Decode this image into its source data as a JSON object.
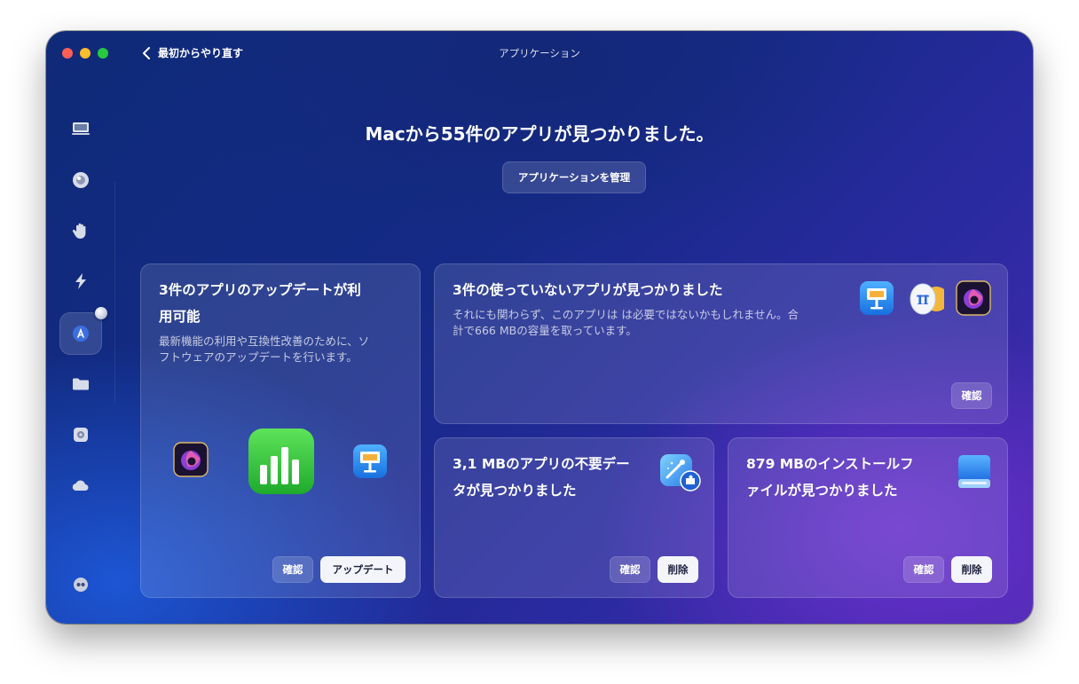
{
  "window": {
    "title": "アプリケーション",
    "back_label": "最初からやり直す"
  },
  "sidebar": {
    "items": [
      {
        "name": "smart-scan-icon"
      },
      {
        "name": "protection-icon"
      },
      {
        "name": "privacy-hand-icon"
      },
      {
        "name": "performance-bolt-icon"
      },
      {
        "name": "applications-icon",
        "active": true
      },
      {
        "name": "my-clutter-folder-icon"
      },
      {
        "name": "system-junk-icon"
      },
      {
        "name": "cloud-icon"
      }
    ],
    "bottom_item": {
      "name": "assistant-icon"
    }
  },
  "main": {
    "headline": "Macから55件のアプリが見つかりました。",
    "manage_button": "アプリケーションを管理"
  },
  "cards": {
    "updates": {
      "title_line1": "3件のアプリのアップデートが利",
      "title_line2": "用可能",
      "desc_line1": "最新機能の利用や互換性改善のために、ソ",
      "desc_line2": "フトウェアのアップデートを行います。",
      "review_label": "確認",
      "update_label": "アップデート",
      "icons": [
        "nova-purple-app-icon",
        "numbers-app-icon",
        "keynote-app-icon"
      ]
    },
    "unused": {
      "title": "3件の使っていないアプリが見つかりました",
      "desc_line1": "それにも関わらず、このアプリは は必要ではないかもしれません。合",
      "desc_line2": "計で666 MBの容量を取っています。",
      "review_label": "確認",
      "icons": [
        "keynote-app-icon",
        "gemini-app-icon",
        "nova-purple-app-icon"
      ]
    },
    "leftovers": {
      "title_line1": "3,1 MBのアプリの不要デー",
      "title_line2": "タが見つかりました",
      "review_label": "確認",
      "remove_label": "削除",
      "icon": "app-leftovers-puzzle-icon"
    },
    "installers": {
      "title_line1": "879 MBのインストールフ",
      "title_line2": "ァイルが見つかりました",
      "review_label": "確認",
      "remove_label": "削除",
      "icon": "installation-drive-icon"
    }
  },
  "colors": {
    "background_top": "#142a86",
    "background_accent": "#7030d2",
    "numbers_green": "#2ec93a",
    "keynote_blue": "#1e8df0",
    "nova_purple": "#8a3fd6"
  }
}
